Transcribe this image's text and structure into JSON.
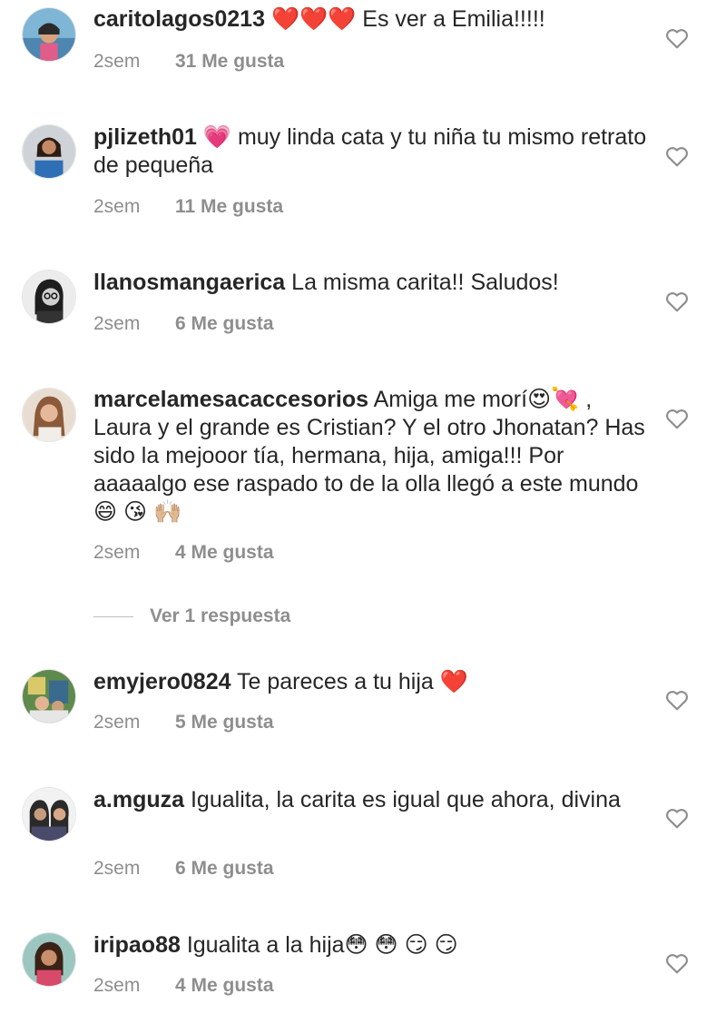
{
  "comments": [
    {
      "username": "caritolagos0213",
      "text": " ❤️❤️❤️ Es ver a Emilia!!!!!",
      "time": "2sem",
      "likes": "31 Me gusta"
    },
    {
      "username": "pjlizeth01",
      "text": " 💗 muy linda cata y tu niña tu mismo retrato de pequeña",
      "time": "2sem",
      "likes": "11 Me gusta"
    },
    {
      "username": "llanosmangaerica",
      "text": " La misma carita!! Saludos!",
      "time": "2sem",
      "likes": "6 Me gusta"
    },
    {
      "username": "marcelamesacaccesorios",
      "text": " Amiga me morí😍💘 , Laura y el grande es Cristian? Y el otro Jhonatan?  Has sido la mejooor tía, hermana, hija, amiga!!! Por aaaaalgo ese raspado to de la olla llegó a este mundo😄 😘 🙌🏼",
      "time": "2sem",
      "likes": "4 Me gusta"
    },
    {
      "username": "emyjero0824",
      "text": " Te pareces a tu hija ❤️",
      "time": "2sem",
      "likes": "5 Me gusta"
    },
    {
      "username": "a.mguza",
      "text": " Igualita, la carita es igual que ahora, divina",
      "time": "2sem",
      "likes": "6 Me gusta"
    },
    {
      "username": "iripao88",
      "text": " Igualita a la hija😳 😳 😏 😏",
      "time": "2sem",
      "likes": "4 Me gusta"
    }
  ],
  "replies": {
    "label": "Ver 1 respuesta"
  },
  "icons": {
    "like": "heart-outline-icon"
  },
  "colors": {
    "text": "#262626",
    "muted": "#8e8e8e"
  }
}
